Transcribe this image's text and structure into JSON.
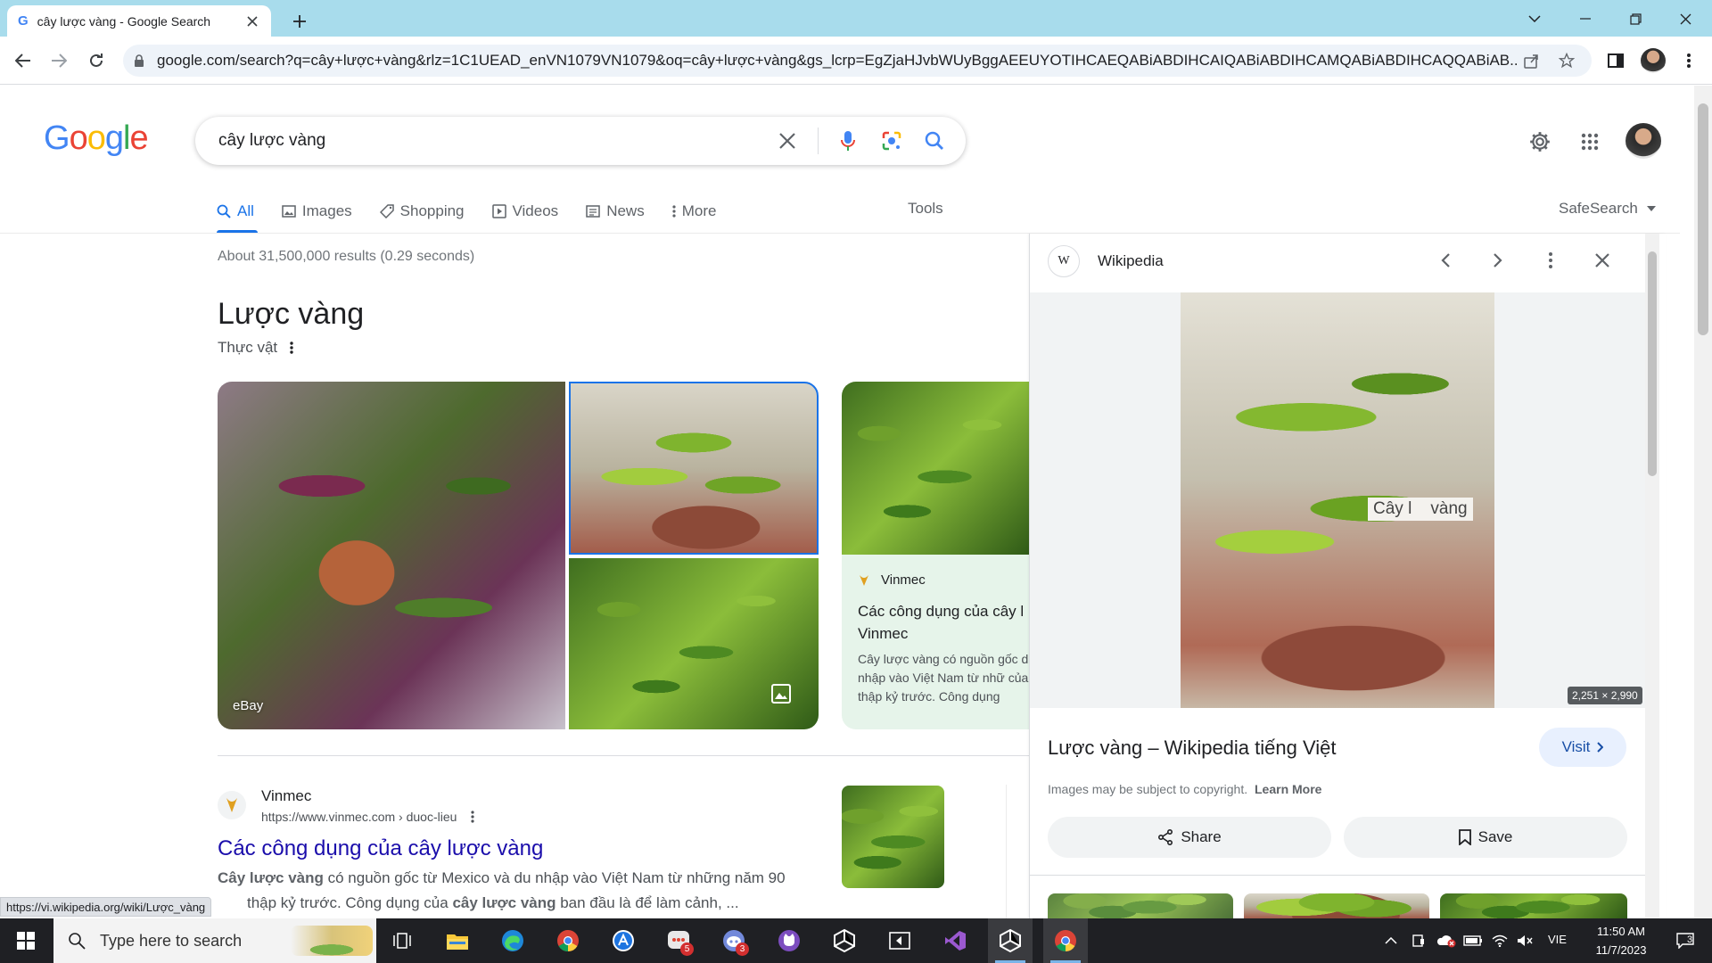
{
  "browser": {
    "tab_title": "cây lược vàng - Google Search",
    "url": "google.com/search?q=cây+lược+vàng&rlz=1C1UEAD_enVN1079VN1079&oq=cây+lược+vàng&gs_lcrp=EgZjaHJvbWUyBggAEEUYOTIHCAEQABiABDIHCAIQABiABDIHCAMQABiABDIHCAQQABiAB..."
  },
  "search": {
    "query": "cây lược vàng",
    "logo": "Google"
  },
  "nav_tabs": [
    {
      "label": "All",
      "icon": "search-icon"
    },
    {
      "label": "Images",
      "icon": "image-icon"
    },
    {
      "label": "Shopping",
      "icon": "tag-icon"
    },
    {
      "label": "Videos",
      "icon": "play-icon"
    },
    {
      "label": "News",
      "icon": "newspaper-icon"
    },
    {
      "label": "More",
      "icon": "kebab-icon"
    }
  ],
  "tools_label": "Tools",
  "safesearch_label": "SafeSearch",
  "result_stats": "About 31,500,000 results (0.29 seconds)",
  "knowledge": {
    "title": "Lược vàng",
    "subtitle": "Thực vật",
    "image_source": "eBay",
    "card_source": "Vinmec",
    "card_title": "Các công dụng của cây l Vinmec",
    "card_snippet": "Cây lược vàng có nguồn gốc du nhập vào Việt Nam từ nhữ của thập kỷ trước. Công dụng"
  },
  "result": {
    "site_name": "Vinmec",
    "url": "https://www.vinmec.com › duoc-lieu",
    "title": "Các công dụng của cây lược vàng",
    "snippet_line1_bold": "Cây lược vàng",
    "snippet_line1_rest": " có nguồn gốc từ Mexico và du nhập vào Việt Nam từ những năm 90",
    "snippet_line2_a": "thập kỷ trước. Công dụng của ",
    "snippet_line2_bold": "cây lược vàng",
    "snippet_line2_b": " ban đầu là để làm cảnh, ..."
  },
  "status_url": "https://vi.wikipedia.org/wiki/Lược_vàng",
  "panel": {
    "source": "Wikipedia",
    "source_icon_letter": "W",
    "image_label_overlay": "Cây l    vàng",
    "dimensions": "2,251 × 2,990",
    "title": "Lược vàng – Wikipedia tiếng Việt",
    "visit_label": "Visit",
    "copyright_text": "Images may be subject to copyright.",
    "learn_more": "Learn More",
    "share_label": "Share",
    "save_label": "Save"
  },
  "taskbar": {
    "search_placeholder": "Type here to search",
    "language": "VIE",
    "time": "11:50 AM",
    "date": "11/7/2023",
    "notification_count": "3",
    "badge_counts": [
      "5",
      "3"
    ]
  },
  "colors": {
    "google_blue": "#4285f4",
    "google_red": "#ea4335",
    "google_yellow": "#fbbc05",
    "google_green": "#34a853",
    "link_blue": "#1a0dab",
    "accent": "#1a73e8"
  }
}
